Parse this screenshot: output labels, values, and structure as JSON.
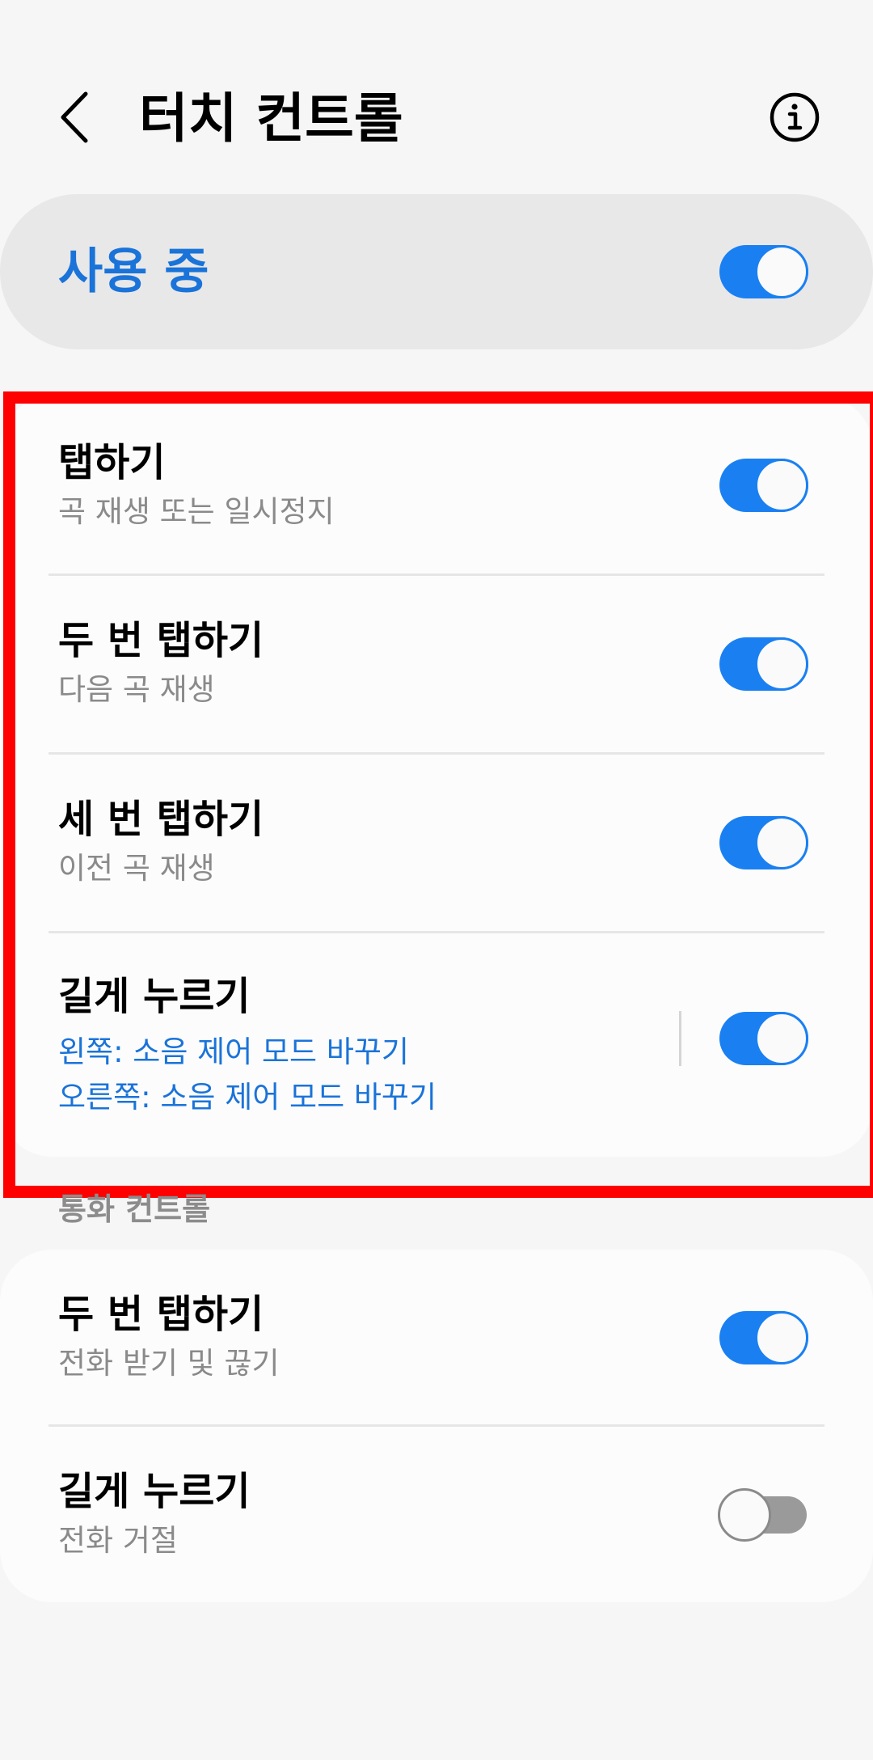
{
  "header": {
    "title": "터치 컨트롤",
    "back_icon": "chevron-left-icon",
    "info_icon": "info-icon"
  },
  "master": {
    "label": "사용 중",
    "enabled": true
  },
  "touch_controls": {
    "items": [
      {
        "title": "탭하기",
        "subtitle": "곡 재생 또는 일시정지",
        "enabled": true
      },
      {
        "title": "두 번 탭하기",
        "subtitle": "다음 곡 재생",
        "enabled": true
      },
      {
        "title": "세 번 탭하기",
        "subtitle": "이전 곡 재생",
        "enabled": true
      },
      {
        "title": "길게 누르기",
        "subtitle_left": "왼쪽: 소음 제어 모드 바꾸기",
        "subtitle_right": "오른쪽: 소음 제어 모드 바꾸기",
        "enabled": true
      }
    ]
  },
  "call_controls": {
    "header": "통화 컨트롤",
    "items": [
      {
        "title": "두 번 탭하기",
        "subtitle": "전화 받기 및 끊기",
        "enabled": true
      },
      {
        "title": "길게 누르기",
        "subtitle": "전화 거절",
        "enabled": false
      }
    ]
  },
  "colors": {
    "accent": "#1a80f2",
    "accent_text": "#1a73d9",
    "highlight": "#ff0000",
    "toggle_off": "#9a9a9a"
  }
}
